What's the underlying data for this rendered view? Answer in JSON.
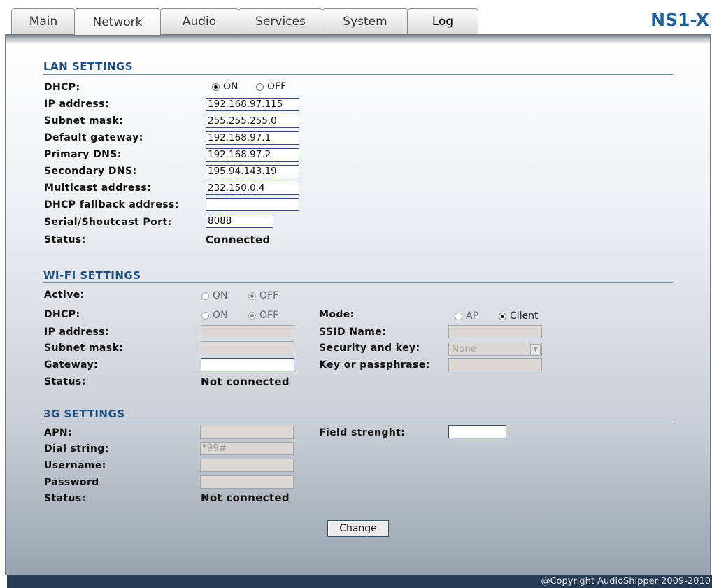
{
  "tabs": [
    "Main",
    "Network",
    "Audio",
    "Services",
    "System",
    "Log"
  ],
  "logo": "NS1-X",
  "lan": {
    "title": "LAN SETTINGS",
    "dhcp_label": "DHCP:",
    "on": "ON",
    "off": "OFF",
    "ip_label": "IP address:",
    "ip": "192.168.97.115",
    "subnet_label": "Subnet mask:",
    "subnet": "255.255.255.0",
    "gateway_label": "Default gateway:",
    "gateway": "192.168.97.1",
    "pdns_label": "Primary DNS:",
    "pdns": "192.168.97.2",
    "sdns_label": "Secondary DNS:",
    "sdns": "195.94.143.19",
    "mcast_label": "Multicast address:",
    "mcast": "232.150.0.4",
    "fallback_label": "DHCP fallback address:",
    "fallback": "",
    "port_label": "Serial/Shoutcast Port:",
    "port": "8088",
    "status_label": "Status:",
    "status": "Connected"
  },
  "wifi": {
    "title": "WI-FI SETTINGS",
    "active_label": "Active:",
    "dhcp_label": "DHCP:",
    "on": "ON",
    "off": "OFF",
    "ip_label": "IP address:",
    "ip": "",
    "subnet_label": "Subnet mask:",
    "subnet": "",
    "gateway_label": "Gateway:",
    "gateway": "",
    "status_label": "Status:",
    "status": "Not connected",
    "mode_label": "Mode:",
    "mode_ap": "AP",
    "mode_client": "Client",
    "ssid_label": "SSID Name:",
    "ssid": "",
    "security_label": "Security and key:",
    "security": "None",
    "key_label": "Key or passphrase:",
    "key": ""
  },
  "g3": {
    "title": "3G SETTINGS",
    "apn_label": "APN:",
    "apn": "",
    "dial_label": "Dial string:",
    "dial": "*99#",
    "user_label": "Username:",
    "user": "",
    "pass_label": "Password",
    "pass": "",
    "status_label": "Status:",
    "status": "Not connected",
    "field_label": "Field strenght:",
    "field": ""
  },
  "change": "Change",
  "footer": "@Copyright AudioShipper 2009-2010"
}
